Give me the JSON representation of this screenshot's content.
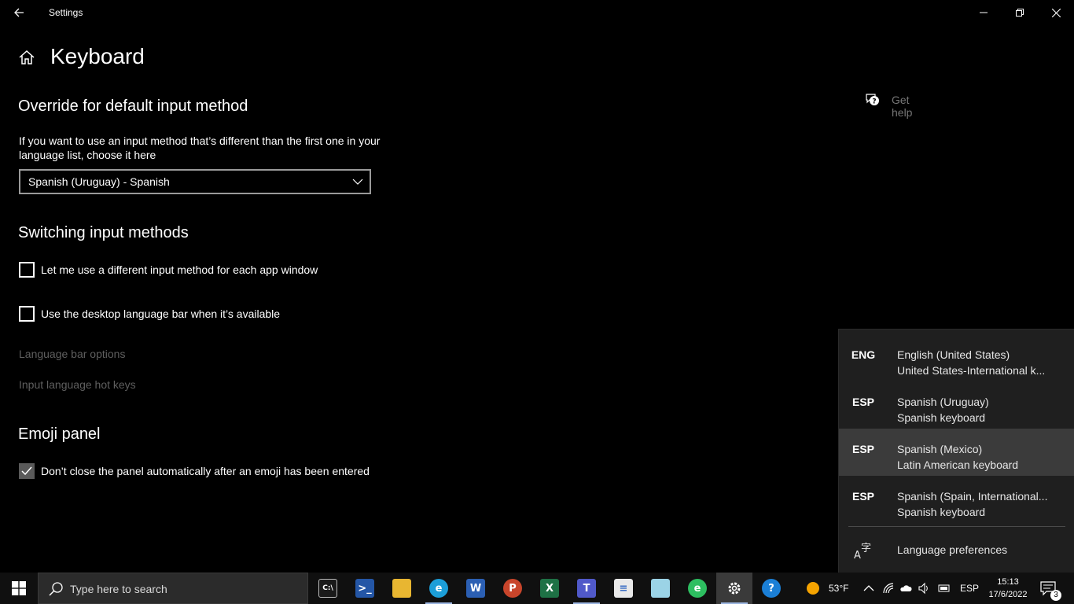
{
  "window": {
    "title": "Settings",
    "back_icon": "back-arrow-icon",
    "minimize_icon": "minimize-icon",
    "restore_icon": "restore-icon",
    "close_icon": "close-icon"
  },
  "page": {
    "home_icon": "home-icon",
    "title": "Keyboard"
  },
  "override": {
    "heading": "Override for default input method",
    "description": "If you want to use an input method that’s different than the first one in your language list, choose it here",
    "selected_value": "Spanish (Uruguay) - Spanish"
  },
  "switching": {
    "heading": "Switching input methods",
    "checkboxes": [
      {
        "label": "Let me use a different input method for each app window",
        "checked": false
      },
      {
        "label": "Use the desktop language bar when it’s available",
        "checked": false
      }
    ],
    "links": [
      "Language bar options",
      "Input language hot keys"
    ]
  },
  "emoji": {
    "heading": "Emoji panel",
    "checkbox": {
      "label": "Don’t close the panel automatically after an emoji has been entered",
      "checked": true
    }
  },
  "help": {
    "label": "Get help",
    "icon": "chat-help-icon"
  },
  "language_flyout": {
    "items": [
      {
        "code": "ENG",
        "name": "English (United States)",
        "keyboard": "United States-International k...",
        "selected": false
      },
      {
        "code": "ESP",
        "name": "Spanish (Uruguay)",
        "keyboard": "Spanish keyboard",
        "selected": false
      },
      {
        "code": "ESP",
        "name": "Spanish (Mexico)",
        "keyboard": "Latin American keyboard",
        "selected": true
      },
      {
        "code": "ESP",
        "name": "Spanish (Spain, International...",
        "keyboard": "Spanish keyboard",
        "selected": false
      }
    ],
    "preferences_label": "Language preferences",
    "preferences_icon": "language-icon"
  },
  "taskbar": {
    "search_placeholder": "Type here to search",
    "apps": [
      "terminal",
      "powershell",
      "file-explorer",
      "edge",
      "word",
      "powerpoint",
      "excel",
      "teams",
      "notepad",
      "paint",
      "evernote",
      "settings",
      "help"
    ],
    "weather": "53°F",
    "input_indicator": "ESP",
    "time": "15:13",
    "date": "17/6/2022",
    "notification_count": "3"
  },
  "colors": {
    "background": "#000000",
    "flyout_bg": "#1f1f1f",
    "flyout_selected": "#3b3b3b",
    "disabled_text": "#5f5f5f",
    "taskbar_bg": "#101010"
  }
}
